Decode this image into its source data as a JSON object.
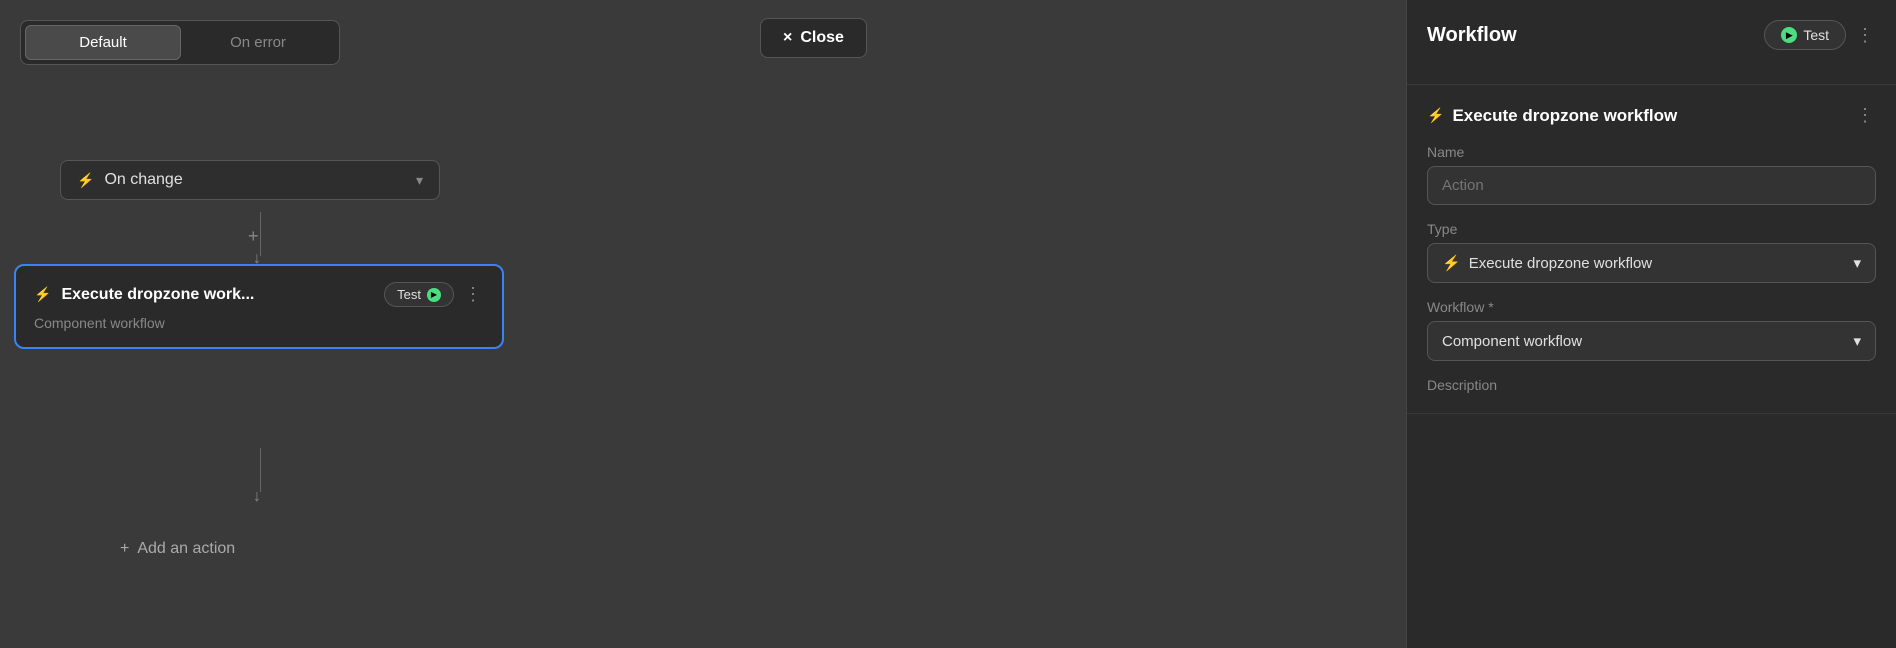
{
  "tabs": {
    "default_label": "Default",
    "on_error_label": "On error"
  },
  "close_button": {
    "label": "Close",
    "icon": "×"
  },
  "trigger": {
    "label": "On change",
    "icon": "⚡"
  },
  "connector": {
    "plus": "+",
    "arrow": "↓"
  },
  "action_node": {
    "title": "Execute dropzone work...",
    "icon": "⚡",
    "test_label": "Test",
    "subtitle": "Component workflow",
    "more_icon": "⋮"
  },
  "add_action": {
    "label": "Add an action",
    "plus": "+"
  },
  "right_panel": {
    "workflow": {
      "title": "Workflow",
      "test_label": "Test",
      "more_icon": "⋮"
    },
    "execute": {
      "title": "Execute dropzone workflow",
      "icon": "⚡",
      "more_icon": "⋮",
      "name_label": "Name",
      "name_placeholder": "Action",
      "type_label": "Type",
      "type_value": "Execute dropzone workflow",
      "type_icon": "⚡",
      "workflow_label": "Workflow *",
      "workflow_value": "Component workflow",
      "description_label": "Description"
    }
  }
}
